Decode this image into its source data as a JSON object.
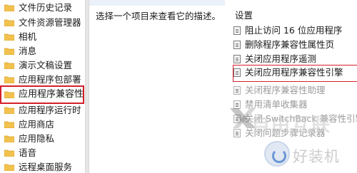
{
  "tree": {
    "items": [
      {
        "label": "文件历史记录"
      },
      {
        "label": "文件资源管理器"
      },
      {
        "label": "相机"
      },
      {
        "label": "消息"
      },
      {
        "label": "演示文稿设置"
      },
      {
        "label": "应用程序包部署"
      },
      {
        "label": "应用程序兼容性",
        "selected": true
      },
      {
        "label": "应用程序运行时"
      },
      {
        "label": "应用商店"
      },
      {
        "label": "应用隐私"
      },
      {
        "label": "语音"
      },
      {
        "label": "远程桌面服务"
      }
    ]
  },
  "description": {
    "text": "选择一个项目来查看它的描述。"
  },
  "settings": {
    "header": "设置",
    "items": [
      {
        "label": "阻止访问 16 位应用程序"
      },
      {
        "label": "删除程序兼容性属性页"
      },
      {
        "label": "关闭应用程序遥测"
      },
      {
        "label": "关闭应用程序兼容性引擎",
        "highlighted": true
      },
      {
        "label": "关闭程序兼容性助理"
      },
      {
        "label": "禁用清单收集器"
      },
      {
        "label": "关闭 SwitchBack 兼容性引擎"
      },
      {
        "label": "关闭问题步骤记录器"
      }
    ]
  },
  "watermark": {
    "brand_text": "自由互联",
    "site_name": "好装机"
  },
  "colors": {
    "highlight_border": "#d4202a",
    "folder": "#f2c14e"
  }
}
